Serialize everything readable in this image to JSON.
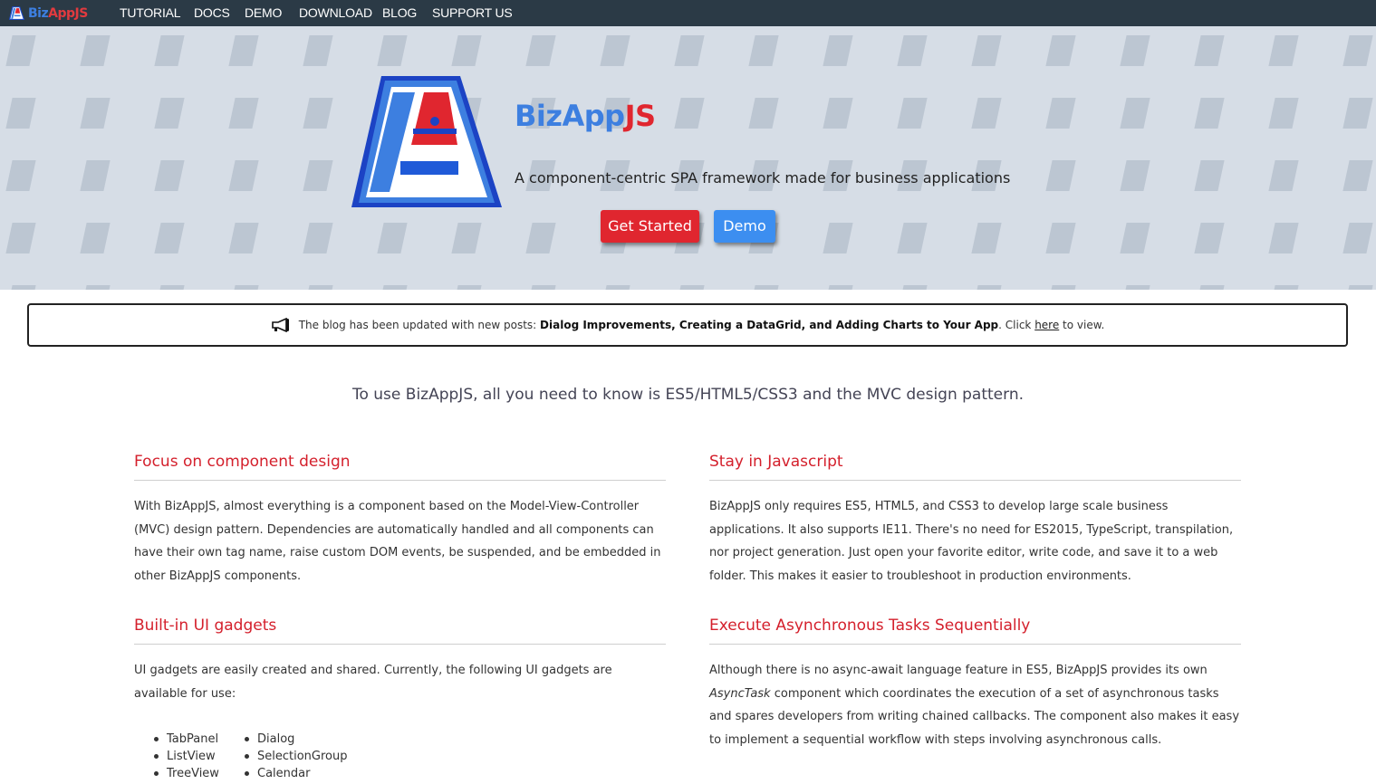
{
  "nav": {
    "brand": {
      "part1": "Biz",
      "part2": "AppJS",
      "icon": "bizappjs-logo-icon"
    },
    "items": [
      "TUTORIAL",
      "DOCS",
      "DEMO",
      "DOWNLOAD",
      "BLOG",
      "SUPPORT US"
    ]
  },
  "hero": {
    "title_part1": "BizApp",
    "title_part2": "JS",
    "subtitle": "A component-centric SPA framework made for business applications",
    "buttons": {
      "get_started": "Get Started",
      "demo": "Demo"
    }
  },
  "notice": {
    "icon": "megaphone-icon",
    "text_before": "The blog has been updated with new posts: ",
    "posts": "Dialog Improvements, Creating a DataGrid, and Adding Charts to Your App",
    "text_mid": ". Click ",
    "link": "here",
    "text_after": " to view."
  },
  "intro": "To use BizAppJS, all you need to know is ES5/HTML5/CSS3 and the MVC design pattern.",
  "sections": {
    "component_design": {
      "title": "Focus on component design",
      "body": "With BizAppJS, almost everything is a component based on the Model-View-Controller (MVC) design pattern. Dependencies are automatically handled and all components can have their own tag name, raise custom DOM events, be suspended, and be embedded in other BizAppJS components."
    },
    "javascript": {
      "title": "Stay in Javascript",
      "body": "BizAppJS only requires ES5, HTML5, and CSS3 to develop large scale business applications. It also supports IE11. There's no need for ES2015, TypeScript, transpilation, nor project generation. Just open your favorite editor, write code, and save it to a web folder. This makes it easier to troubleshoot in production environments."
    },
    "gadgets": {
      "title": "Built-in UI gadgets",
      "body": "UI gadgets are easily created and shared. Currently, the following UI gadgets are available for use:",
      "col1": [
        "TabPanel",
        "ListView",
        "TreeView"
      ],
      "col2": [
        "Dialog",
        "SelectionGroup",
        "Calendar"
      ]
    },
    "async": {
      "title": "Execute Asynchronous Tasks Sequentially",
      "body_before": "Although there is no async-await language feature in ES5, BizAppJS provides its own ",
      "body_em": "AsyncTask",
      "body_after": " component which coordinates the execution of a set of asynchronous tasks and spares developers from writing chained callbacks. The component also makes it easy to implement a sequential workflow with steps involving asynchronous calls."
    }
  },
  "colors": {
    "nav_bg": "#2b3a46",
    "brand_blue": "#3d7fe0",
    "brand_red": "#e0262f",
    "hero_bg": "#d6dde6",
    "heading_red": "#d4202c"
  }
}
